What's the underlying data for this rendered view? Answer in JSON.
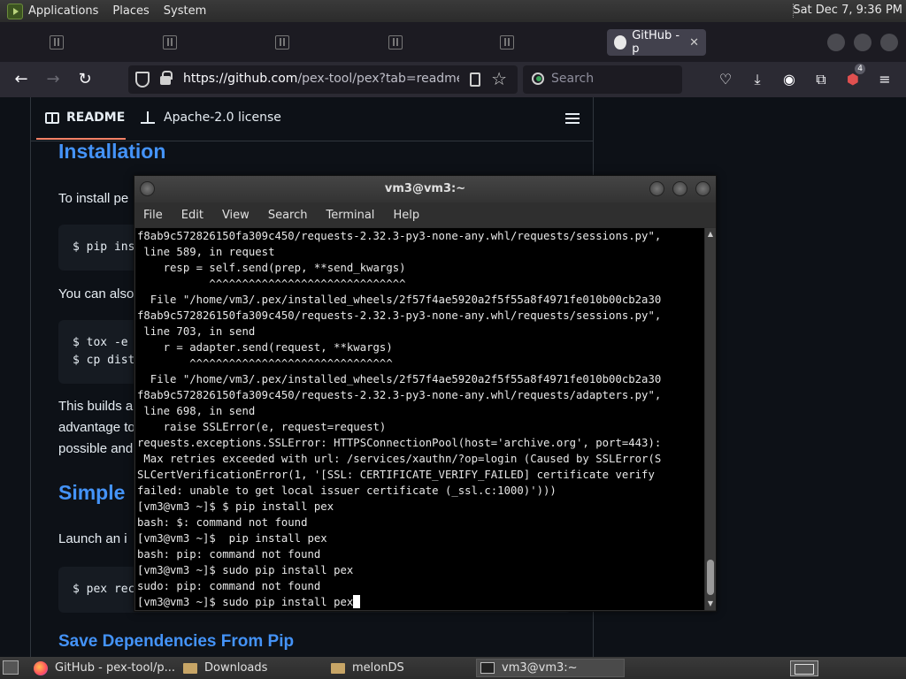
{
  "top_panel": {
    "menus": [
      "Applications",
      "Places",
      "System"
    ],
    "clock": "Sat Dec  7,  9:36 PM"
  },
  "browser": {
    "tabs": [
      {
        "label": "",
        "state": "faded"
      },
      {
        "label": "",
        "state": "faded"
      },
      {
        "label": "",
        "state": "faded"
      },
      {
        "label": "",
        "state": "faded"
      },
      {
        "label": "",
        "state": "faded"
      },
      {
        "label": "GitHub - p",
        "state": "active"
      }
    ],
    "url_host": "https://github.com",
    "url_path": "/pex-tool/pex?tab=readme-ov-",
    "search_placeholder": "Search",
    "extension_badge": "4"
  },
  "readme": {
    "tab_readme": "README",
    "tab_license": "Apache-2.0 license",
    "heading_installation": "Installation",
    "para_install": "To install pe",
    "code_1": "$ pip ins",
    "para_also": "You can also",
    "code_2_line1": "$ tox -e",
    "code_2_line2": "$ cp dist",
    "para_builds_1": "This builds a",
    "para_builds_2": "advantage to",
    "para_builds_3": "possible and",
    "heading_simple": "Simple",
    "para_launch": "Launch an i",
    "code_3": "$ pex rec",
    "heading_save": "Save Dependencies From Pip"
  },
  "terminal": {
    "title": "vm3@vm3:~",
    "menu": [
      "File",
      "Edit",
      "View",
      "Search",
      "Terminal",
      "Help"
    ],
    "lines": [
      "f8ab9c572826150fa309c450/requests-2.32.3-py3-none-any.whl/requests/sessions.py\",",
      " line 589, in request",
      "    resp = self.send(prep, **send_kwargs)",
      "           ^^^^^^^^^^^^^^^^^^^^^^^^^^^^^^",
      "  File \"/home/vm3/.pex/installed_wheels/2f57f4ae5920a2f5f55a8f4971fe010b00cb2a30",
      "f8ab9c572826150fa309c450/requests-2.32.3-py3-none-any.whl/requests/sessions.py\",",
      " line 703, in send",
      "    r = adapter.send(request, **kwargs)",
      "        ^^^^^^^^^^^^^^^^^^^^^^^^^^^^^^^",
      "  File \"/home/vm3/.pex/installed_wheels/2f57f4ae5920a2f5f55a8f4971fe010b00cb2a30",
      "f8ab9c572826150fa309c450/requests-2.32.3-py3-none-any.whl/requests/adapters.py\",",
      " line 698, in send",
      "    raise SSLError(e, request=request)",
      "requests.exceptions.SSLError: HTTPSConnectionPool(host='archive.org', port=443):",
      " Max retries exceeded with url: /services/xauthn/?op=login (Caused by SSLError(S",
      "SLCertVerificationError(1, '[SSL: CERTIFICATE_VERIFY_FAILED] certificate verify",
      "failed: unable to get local issuer certificate (_ssl.c:1000)')))",
      "[vm3@vm3 ~]$ $ pip install pex",
      "bash: $: command not found",
      "[vm3@vm3 ~]$  pip install pex",
      "bash: pip: command not found",
      "[vm3@vm3 ~]$ sudo pip install pex",
      "sudo: pip: command not found",
      "[vm3@vm3 ~]$ sudo pip install pex"
    ]
  },
  "taskbar": {
    "tasks": [
      "GitHub - pex-tool/p...",
      "Downloads",
      "melonDS",
      "vm3@vm3:~"
    ]
  }
}
